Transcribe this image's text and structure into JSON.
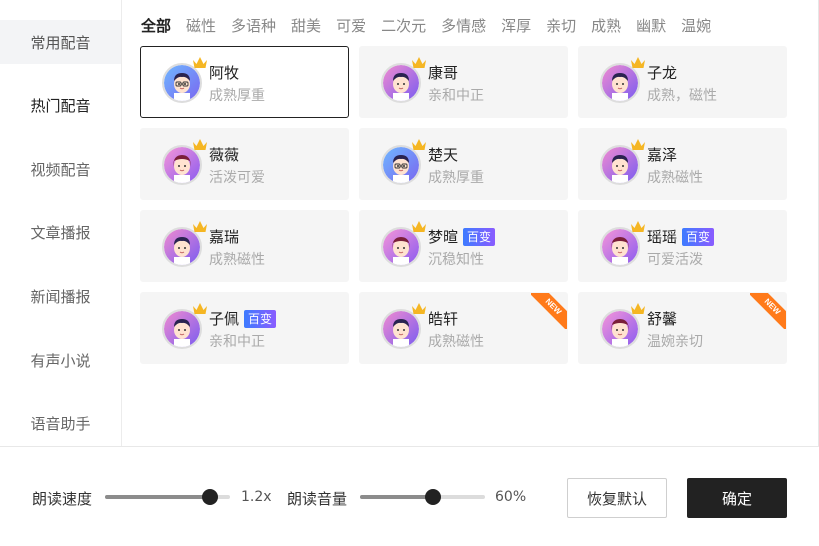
{
  "sidebar": {
    "items": [
      {
        "label": "常用配音"
      },
      {
        "label": "热门配音"
      },
      {
        "label": "视频配音"
      },
      {
        "label": "文章播报"
      },
      {
        "label": "新闻播报"
      },
      {
        "label": "有声小说"
      },
      {
        "label": "语音助手"
      }
    ]
  },
  "tabs": [
    "全部",
    "磁性",
    "多语种",
    "甜美",
    "可爱",
    "二次元",
    "多情感",
    "浑厚",
    "亲切",
    "成熟",
    "幽默",
    "温婉"
  ],
  "voices": [
    {
      "name": "阿牧",
      "desc": "成熟厚重",
      "badge": "",
      "new": false,
      "avatar": "man-glasses-icon",
      "selected": true
    },
    {
      "name": "康哥",
      "desc": "亲和中正",
      "badge": "",
      "new": false,
      "avatar": "man-icon",
      "selected": false
    },
    {
      "name": "子龙",
      "desc": "成熟，磁性",
      "badge": "",
      "new": false,
      "avatar": "man-icon",
      "selected": false
    },
    {
      "name": "薇薇",
      "desc": "活泼可爱",
      "badge": "",
      "new": false,
      "avatar": "woman-icon",
      "selected": false
    },
    {
      "name": "楚天",
      "desc": "成熟厚重",
      "badge": "",
      "new": false,
      "avatar": "man-glasses-icon",
      "selected": false
    },
    {
      "name": "嘉泽",
      "desc": "成熟磁性",
      "badge": "",
      "new": false,
      "avatar": "man-icon",
      "selected": false
    },
    {
      "name": "嘉瑞",
      "desc": "成熟磁性",
      "badge": "",
      "new": false,
      "avatar": "man-icon",
      "selected": false
    },
    {
      "name": "梦暄",
      "desc": "沉稳知性",
      "badge": "百变",
      "new": false,
      "avatar": "woman-icon",
      "selected": false
    },
    {
      "name": "瑶瑶",
      "desc": "可爱活泼",
      "badge": "百变",
      "new": false,
      "avatar": "woman-icon",
      "selected": false
    },
    {
      "name": "子佩",
      "desc": "亲和中正",
      "badge": "百变",
      "new": false,
      "avatar": "man-icon",
      "selected": false
    },
    {
      "name": "皓轩",
      "desc": "成熟磁性",
      "badge": "",
      "new": true,
      "avatar": "man-icon",
      "selected": false
    },
    {
      "name": "舒馨",
      "desc": "温婉亲切",
      "badge": "",
      "new": true,
      "avatar": "woman-icon",
      "selected": false
    }
  ],
  "new_label": "NEW",
  "controls": {
    "speed_label": "朗读速度",
    "speed_value": "1.2x",
    "speed_fraction": 0.84,
    "volume_label": "朗读音量",
    "volume_value": "60%",
    "volume_fraction": 0.58
  },
  "buttons": {
    "reset": "恢复默认",
    "confirm": "确定"
  },
  "colors": {
    "accent": "#222222",
    "badge_from": "#3d7bff",
    "badge_to": "#8a5cff",
    "new_ribbon": "#ff7a1a",
    "crown": "#f5b623"
  }
}
